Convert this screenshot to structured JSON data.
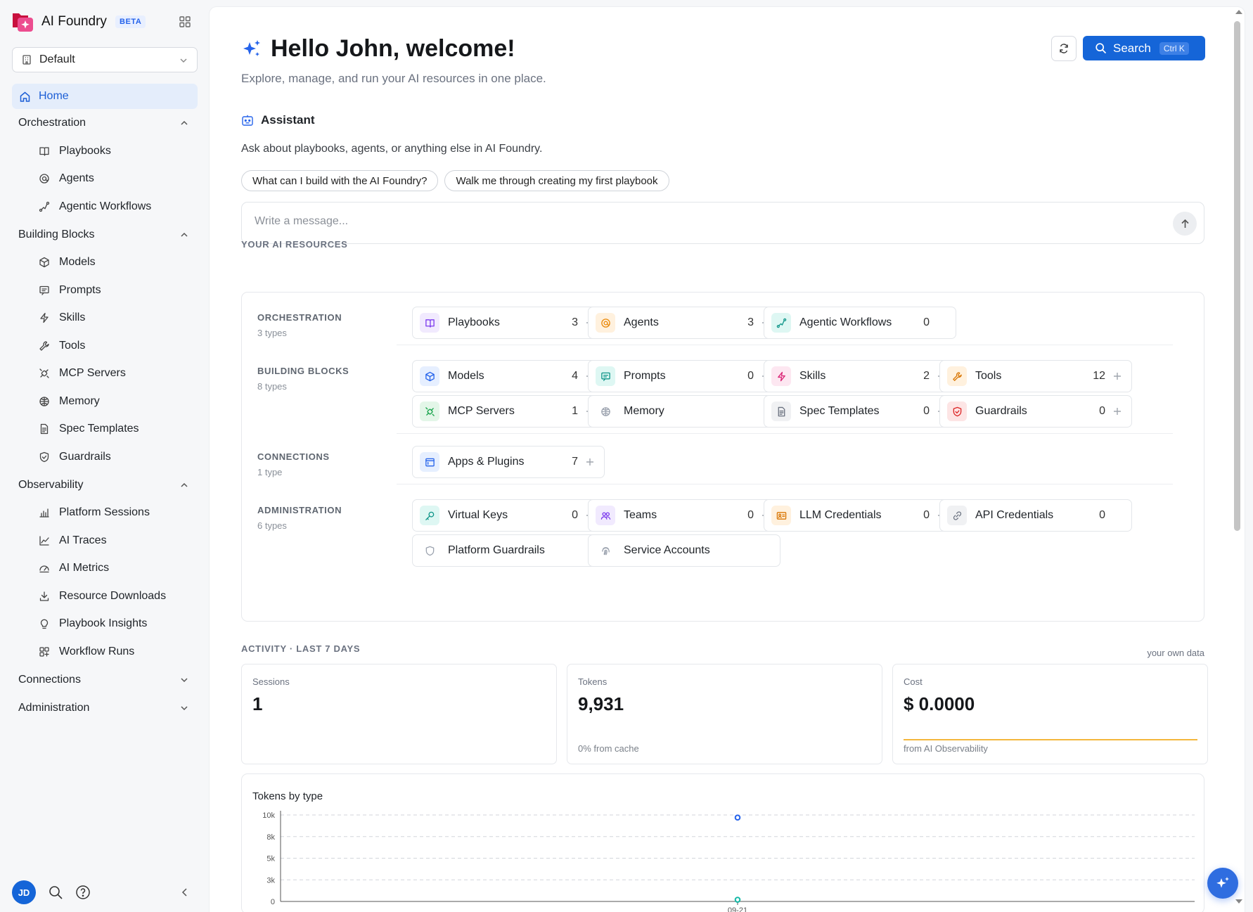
{
  "brand": {
    "name": "AI Foundry",
    "badge": "BETA"
  },
  "workspace": {
    "selected": "Default"
  },
  "nav": {
    "home": "Home",
    "groups": [
      {
        "label": "Orchestration",
        "expanded": true,
        "items": [
          "Playbooks",
          "Agents",
          "Agentic Workflows"
        ]
      },
      {
        "label": "Building Blocks",
        "expanded": true,
        "items": [
          "Models",
          "Prompts",
          "Skills",
          "Tools",
          "MCP Servers",
          "Memory",
          "Spec Templates",
          "Guardrails"
        ]
      },
      {
        "label": "Observability",
        "expanded": true,
        "items": [
          "Platform Sessions",
          "AI Traces",
          "AI Metrics",
          "Resource Downloads",
          "Playbook Insights",
          "Workflow Runs"
        ]
      },
      {
        "label": "Connections",
        "expanded": false,
        "items": []
      },
      {
        "label": "Administration",
        "expanded": false,
        "items": []
      }
    ]
  },
  "user": {
    "initials": "JD"
  },
  "header": {
    "title": "Hello John, welcome!",
    "subtitle": "Explore, manage, and run your AI resources in one place.",
    "search_label": "Search",
    "search_shortcut": "Ctrl K"
  },
  "assistant": {
    "title": "Assistant",
    "description": "Ask about playbooks, agents, or anything else in AI Foundry.",
    "suggestions": [
      "What can I build with the AI Foundry?",
      "Walk me through creating my first playbook"
    ],
    "input_placeholder": "Write a message..."
  },
  "resources": {
    "heading": "YOUR AI RESOURCES",
    "sections": [
      {
        "label": "ORCHESTRATION",
        "count": "3 types",
        "cards": [
          {
            "name": "Playbooks",
            "count": "3",
            "add": true,
            "icon": "book-icon",
            "color": "#7c3aed",
            "bg": "#f1eafe"
          },
          {
            "name": "Agents",
            "count": "3",
            "add": true,
            "icon": "bot-icon",
            "color": "#ea8a0c",
            "bg": "#fff1de"
          },
          {
            "name": "Agentic Workflows",
            "count": "0",
            "add": false,
            "icon": "workflow-icon",
            "color": "#0d9488",
            "bg": "#def7f3"
          }
        ]
      },
      {
        "label": "BUILDING BLOCKS",
        "count": "8 types",
        "cards": [
          {
            "name": "Models",
            "count": "4",
            "add": true,
            "icon": "cube-icon",
            "color": "#2563eb",
            "bg": "#e6efff"
          },
          {
            "name": "Prompts",
            "count": "0",
            "add": true,
            "icon": "message-icon",
            "color": "#0d9488",
            "bg": "#def7f3"
          },
          {
            "name": "Skills",
            "count": "2",
            "add": true,
            "icon": "bolt-icon",
            "color": "#db2777",
            "bg": "#fde7f1"
          },
          {
            "name": "Tools",
            "count": "12",
            "add": true,
            "icon": "wrench-icon",
            "color": "#d97706",
            "bg": "#fff1de"
          },
          {
            "name": "MCP Servers",
            "count": "1",
            "add": true,
            "icon": "plug-icon",
            "color": "#16a34a",
            "bg": "#e3f6e8"
          },
          {
            "name": "Memory",
            "count": "",
            "add": false,
            "icon": "brain-icon",
            "color": "#9ca3af",
            "bg": "#ffffff"
          },
          {
            "name": "Spec Templates",
            "count": "0",
            "add": true,
            "icon": "file-icon",
            "color": "#6b7280",
            "bg": "#f0f1f3"
          },
          {
            "name": "Guardrails",
            "count": "0",
            "add": true,
            "icon": "shield-icon",
            "color": "#dc2626",
            "bg": "#fde5e5"
          }
        ]
      },
      {
        "label": "CONNECTIONS",
        "count": "1 type",
        "cards": [
          {
            "name": "Apps & Plugins",
            "count": "7",
            "add": true,
            "icon": "window-icon",
            "color": "#2563eb",
            "bg": "#e6efff"
          }
        ]
      },
      {
        "label": "ADMINISTRATION",
        "count": "6 types",
        "cards": [
          {
            "name": "Virtual Keys",
            "count": "0",
            "add": true,
            "icon": "key-icon",
            "color": "#0d9488",
            "bg": "#def7f3"
          },
          {
            "name": "Teams",
            "count": "0",
            "add": true,
            "icon": "users-icon",
            "color": "#7c3aed",
            "bg": "#f1eafe"
          },
          {
            "name": "LLM Credentials",
            "count": "0",
            "add": true,
            "icon": "id-card-icon",
            "color": "#d97706",
            "bg": "#fff1de"
          },
          {
            "name": "API Credentials",
            "count": "0",
            "add": false,
            "icon": "link-icon",
            "color": "#6b7280",
            "bg": "#f0f1f3"
          },
          {
            "name": "Platform Guardrails",
            "count": "",
            "add": false,
            "icon": "shield-outline-icon",
            "color": "#9ca3af",
            "bg": "#ffffff"
          },
          {
            "name": "Service Accounts",
            "count": "",
            "add": false,
            "icon": "fingerprint-icon",
            "color": "#9ca3af",
            "bg": "#ffffff"
          }
        ]
      }
    ]
  },
  "activity": {
    "heading": "ACTIVITY · LAST 7 DAYS",
    "note": "your own data",
    "stats": [
      {
        "label": "Sessions",
        "value": "1",
        "note": ""
      },
      {
        "label": "Tokens",
        "value": "9,931",
        "note": "0% from cache"
      },
      {
        "label": "Cost",
        "value": "$ 0.0000",
        "note": "from AI Observability"
      }
    ]
  },
  "chart_data": {
    "type": "scatter",
    "title": "Tokens by type",
    "x": [
      "09-21"
    ],
    "yticks": [
      "0",
      "3k",
      "5k",
      "8k",
      "10k"
    ],
    "ylim": [
      0,
      10000
    ],
    "grid": true,
    "series": [
      {
        "values": [
          9700
        ],
        "color": "#2563eb"
      },
      {
        "values": [
          200
        ],
        "color": "#14b8a6"
      }
    ]
  }
}
